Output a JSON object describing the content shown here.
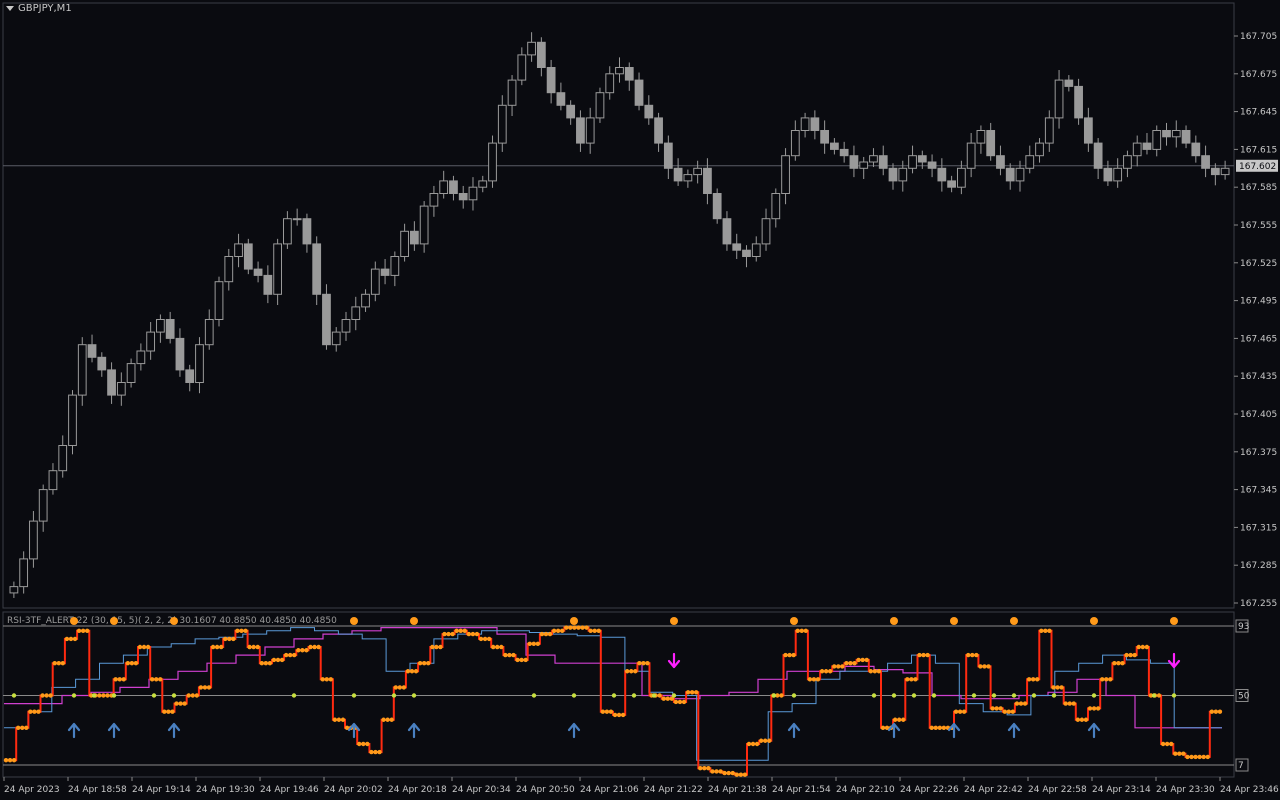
{
  "symbol": "GBPJPY,M1",
  "indicator_label": "RSI-3TF_ALERT 22 (30, 15, 5)( 2, 2, 2)  30.1607 40.8850 40.4850 40.4850",
  "colors": {
    "background": "#0a0b10",
    "candle": "#9a9a9a",
    "grid": "#3a3d46",
    "rsi_main": "#ff2a10",
    "rsi_dots": "#ff9a1a",
    "tf_blue": "#5a9ad8",
    "tf_magenta": "#d040d0",
    "arrow_up": "#4a80c0",
    "arrow_down": "#ff20ff",
    "mid_dot": "#c8e040"
  },
  "price_axis": {
    "labels": [
      "167.705",
      "167.675",
      "167.645",
      "167.615",
      "167.585",
      "167.555",
      "167.525",
      "167.495",
      "167.465",
      "167.435",
      "167.405",
      "167.375",
      "167.345",
      "167.315",
      "167.285",
      "167.255"
    ],
    "current_price": "167.602"
  },
  "indicator_axis": {
    "labels": [
      "93",
      "50",
      "7"
    ]
  },
  "time_axis": {
    "labels": [
      "24 Apr 2023",
      "24 Apr 18:58",
      "24 Apr 19:14",
      "24 Apr 19:30",
      "24 Apr 19:46",
      "24 Apr 20:02",
      "24 Apr 20:18",
      "24 Apr 20:34",
      "24 Apr 20:50",
      "24 Apr 21:06",
      "24 Apr 21:22",
      "24 Apr 21:38",
      "24 Apr 21:54",
      "24 Apr 22:10",
      "24 Apr 22:26",
      "24 Apr 22:42",
      "24 Apr 22:58",
      "24 Apr 23:14",
      "24 Apr 23:30",
      "24 Apr 23:46"
    ]
  },
  "chart_data": {
    "type": "candlestick",
    "price_close": [
      167.268,
      167.29,
      167.32,
      167.345,
      167.36,
      167.38,
      167.42,
      167.46,
      167.45,
      167.44,
      167.42,
      167.43,
      167.445,
      167.455,
      167.47,
      167.48,
      167.465,
      167.44,
      167.43,
      167.46,
      167.48,
      167.51,
      167.53,
      167.54,
      167.52,
      167.515,
      167.5,
      167.54,
      167.56,
      167.56,
      167.54,
      167.5,
      167.46,
      167.47,
      167.48,
      167.49,
      167.5,
      167.52,
      167.515,
      167.53,
      167.55,
      167.54,
      167.57,
      167.58,
      167.59,
      167.58,
      167.575,
      167.585,
      167.59,
      167.62,
      167.65,
      167.67,
      167.69,
      167.7,
      167.68,
      167.66,
      167.65,
      167.64,
      167.62,
      167.64,
      167.66,
      167.675,
      167.68,
      167.67,
      167.65,
      167.64,
      167.62,
      167.6,
      167.59,
      167.595,
      167.6,
      167.58,
      167.56,
      167.54,
      167.535,
      167.53,
      167.54,
      167.56,
      167.58,
      167.61,
      167.63,
      167.64,
      167.63,
      167.62,
      167.615,
      167.61,
      167.6,
      167.605,
      167.61,
      167.6,
      167.59,
      167.6,
      167.61,
      167.605,
      167.6,
      167.59,
      167.585,
      167.6,
      167.62,
      167.63,
      167.61,
      167.6,
      167.59,
      167.6,
      167.61,
      167.62,
      167.64,
      167.67,
      167.665,
      167.64,
      167.62,
      167.6,
      167.59,
      167.6,
      167.61,
      167.62,
      167.615,
      167.63,
      167.625,
      167.63,
      167.62,
      167.61,
      167.6,
      167.595,
      167.6
    ],
    "rsi_fast": [
      10,
      30,
      40,
      50,
      70,
      85,
      90,
      50,
      50,
      60,
      70,
      80,
      60,
      40,
      45,
      50,
      55,
      80,
      85,
      90,
      80,
      70,
      72,
      75,
      78,
      80,
      60,
      35,
      30,
      20,
      15,
      35,
      55,
      65,
      70,
      80,
      88,
      90,
      88,
      85,
      80,
      75,
      72,
      82,
      88,
      90,
      92,
      92,
      90,
      40,
      38,
      65,
      70,
      50,
      48,
      46,
      52,
      5,
      3,
      2,
      1,
      20,
      22,
      50,
      75,
      90,
      60,
      65,
      68,
      70,
      72,
      65,
      30,
      35,
      60,
      75,
      30,
      30,
      40,
      75,
      68,
      42,
      40,
      45,
      60,
      90,
      55,
      45,
      35,
      42,
      60,
      70,
      75,
      80,
      50,
      20,
      14,
      12,
      12,
      40
    ],
    "tf_medium": [
      30,
      40,
      55,
      60,
      70,
      75,
      80,
      82,
      85,
      86,
      88,
      90,
      92,
      90,
      88,
      85,
      65,
      70,
      85,
      88,
      90,
      90,
      89,
      88,
      87,
      86,
      65,
      52,
      50,
      10,
      10,
      10,
      40,
      45,
      60,
      65,
      65,
      70,
      75,
      70,
      45,
      40,
      38,
      50,
      65,
      70,
      75,
      72,
      70,
      30,
      30
    ],
    "tf_slow": [
      45,
      45,
      50,
      52,
      55,
      60,
      65,
      70,
      75,
      80,
      85,
      88,
      90,
      92,
      92,
      92,
      92,
      88,
      75,
      70,
      70,
      70,
      50,
      48,
      50,
      52,
      60,
      65,
      65,
      68,
      66,
      64,
      50,
      48,
      48,
      50,
      52,
      60,
      50,
      30,
      30,
      30
    ],
    "markers": "up/down arrows and dots shown on indicator pane"
  }
}
